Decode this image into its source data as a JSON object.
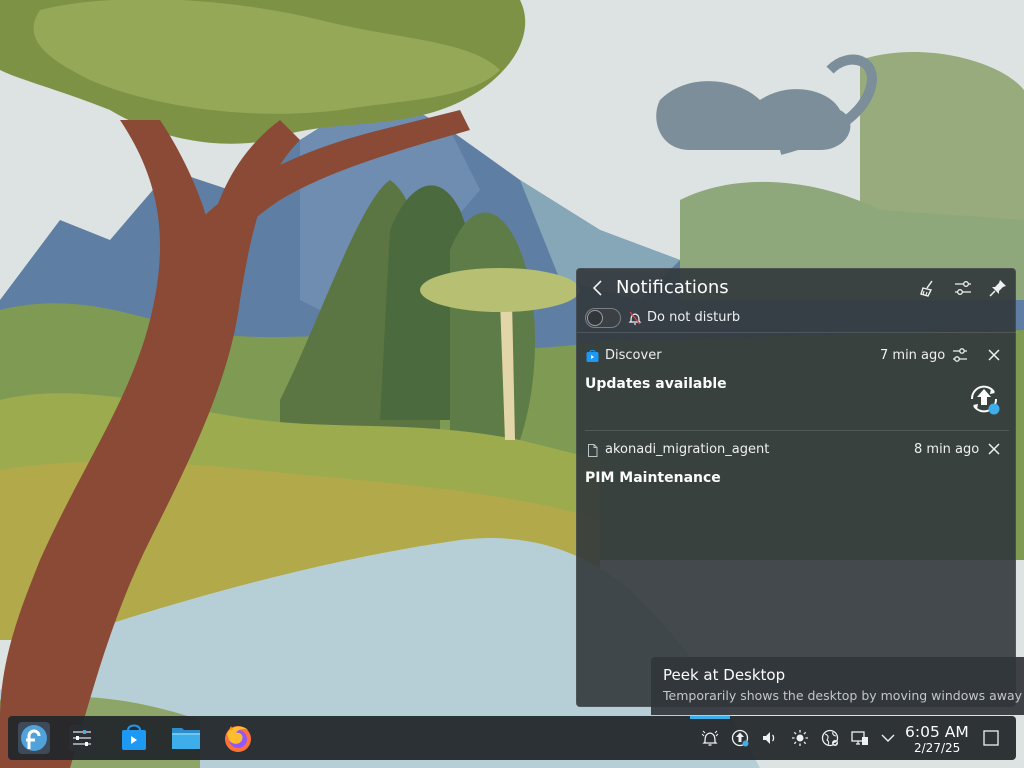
{
  "notifications_panel": {
    "title": "Notifications",
    "dnd_label": "Do not disturb",
    "items": [
      {
        "app": "Discover",
        "time": "7 min ago",
        "title": "Updates available"
      },
      {
        "app": "akonadi_migration_agent",
        "time": "8 min ago",
        "title": "PIM Maintenance"
      }
    ]
  },
  "tooltip": {
    "title": "Peek at Desktop",
    "subtitle": "Temporarily shows the desktop by moving windows away"
  },
  "taskbar": {
    "apps": [
      "fedora-launcher-icon",
      "system-settings-icon",
      "discover-icon",
      "dolphin-icon",
      "firefox-icon"
    ],
    "tray_icons": [
      "notifications-bell-icon",
      "updates-icon",
      "volume-icon",
      "brightness-icon",
      "network-icon",
      "display-icon",
      "expand-tray-icon"
    ],
    "clock": {
      "time": "6:05 AM",
      "date": "2/27/25"
    }
  },
  "colors": {
    "accent": "#3daee9",
    "panel": "#32373c"
  }
}
